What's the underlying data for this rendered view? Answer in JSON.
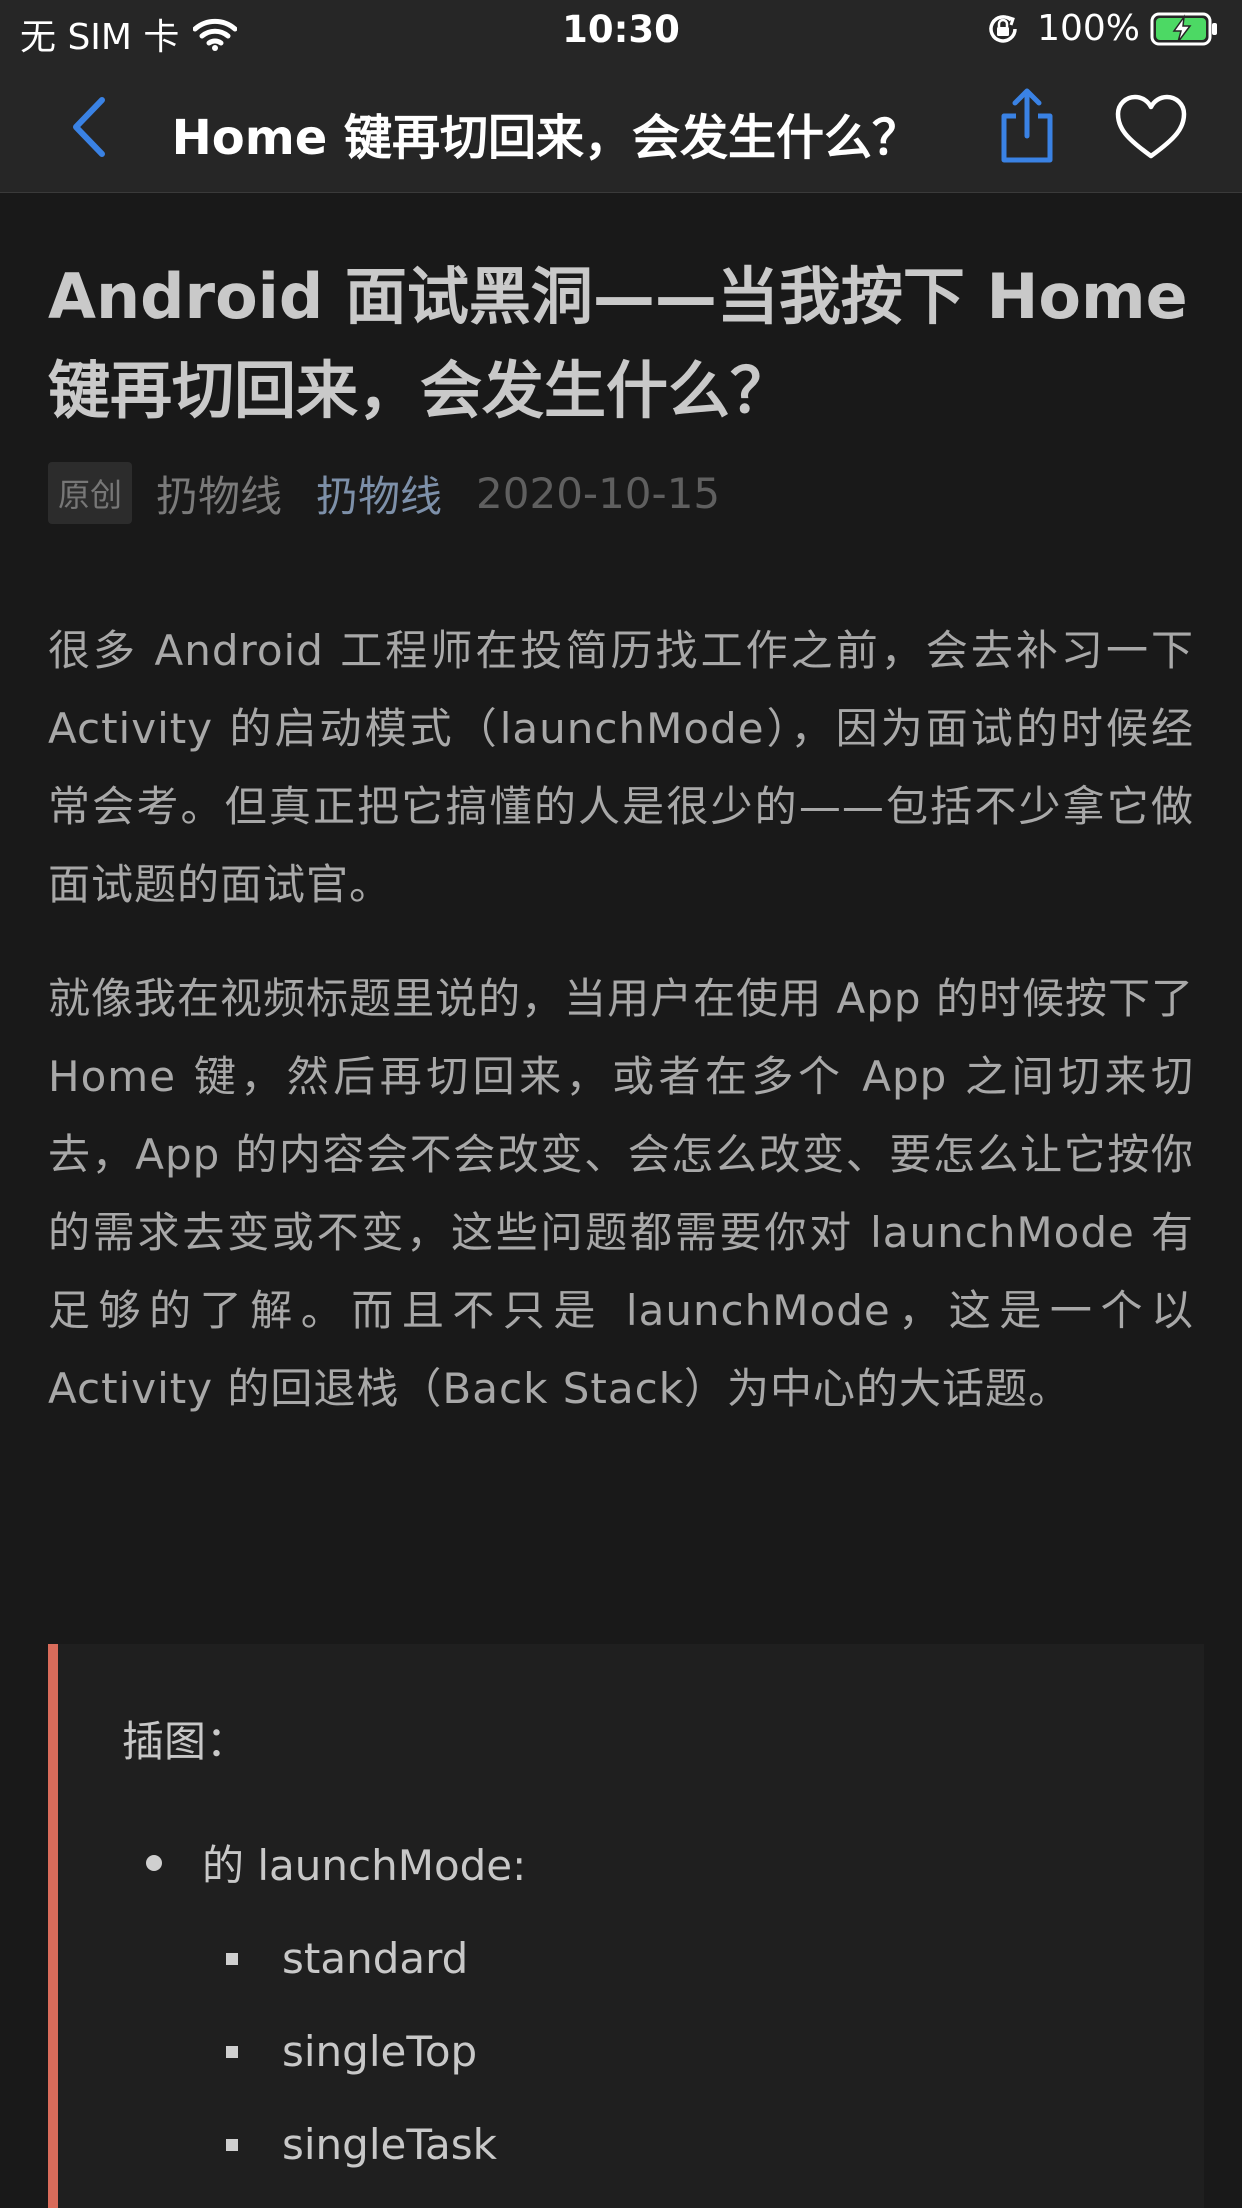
{
  "status_bar": {
    "carrier": "无 SIM 卡",
    "time": "10:30",
    "battery": "100%"
  },
  "nav": {
    "title": "Android 面试黑洞——当我按下 Home 键再切回来，会发生什么？"
  },
  "article": {
    "title": "Android 面试黑洞——当我按下 Home 键再切回来，会发生什么？",
    "tag": "原创",
    "author": "扔物线",
    "account": "扔物线",
    "date": "2020-10-15",
    "paragraphs": [
      "很多 Android 工程师在投简历找工作之前，会去补习一下 Activity 的启动模式（launchMode），因为面试的时候经常会考。但真正把它搞懂的人是很少的——包括不少拿它做面试题的面试官。",
      "就像我在视频标题里说的，当用户在使用 App 的时候按下了 Home 键，然后再切回来，或者在多个 App 之间切来切去，App 的内容会不会改变、会怎么改变、要怎么让它按你的需求去变或不变，这些问题都需要你对 launchMode 有足够的了解。而且不只是 launchMode，这是一个以 Activity 的回退栈（Back Stack）为中心的大话题。"
    ],
    "quote": {
      "label": "插图：",
      "bullet": "的 launchMode:",
      "items": [
        "standard",
        "singleTop",
        "singleTask"
      ]
    }
  },
  "colors": {
    "background": "#191919",
    "nav_background": "#262626",
    "accent_blue": "#3a82e4",
    "quote_border": "#d96c5b",
    "account_link": "#7d90a9"
  }
}
